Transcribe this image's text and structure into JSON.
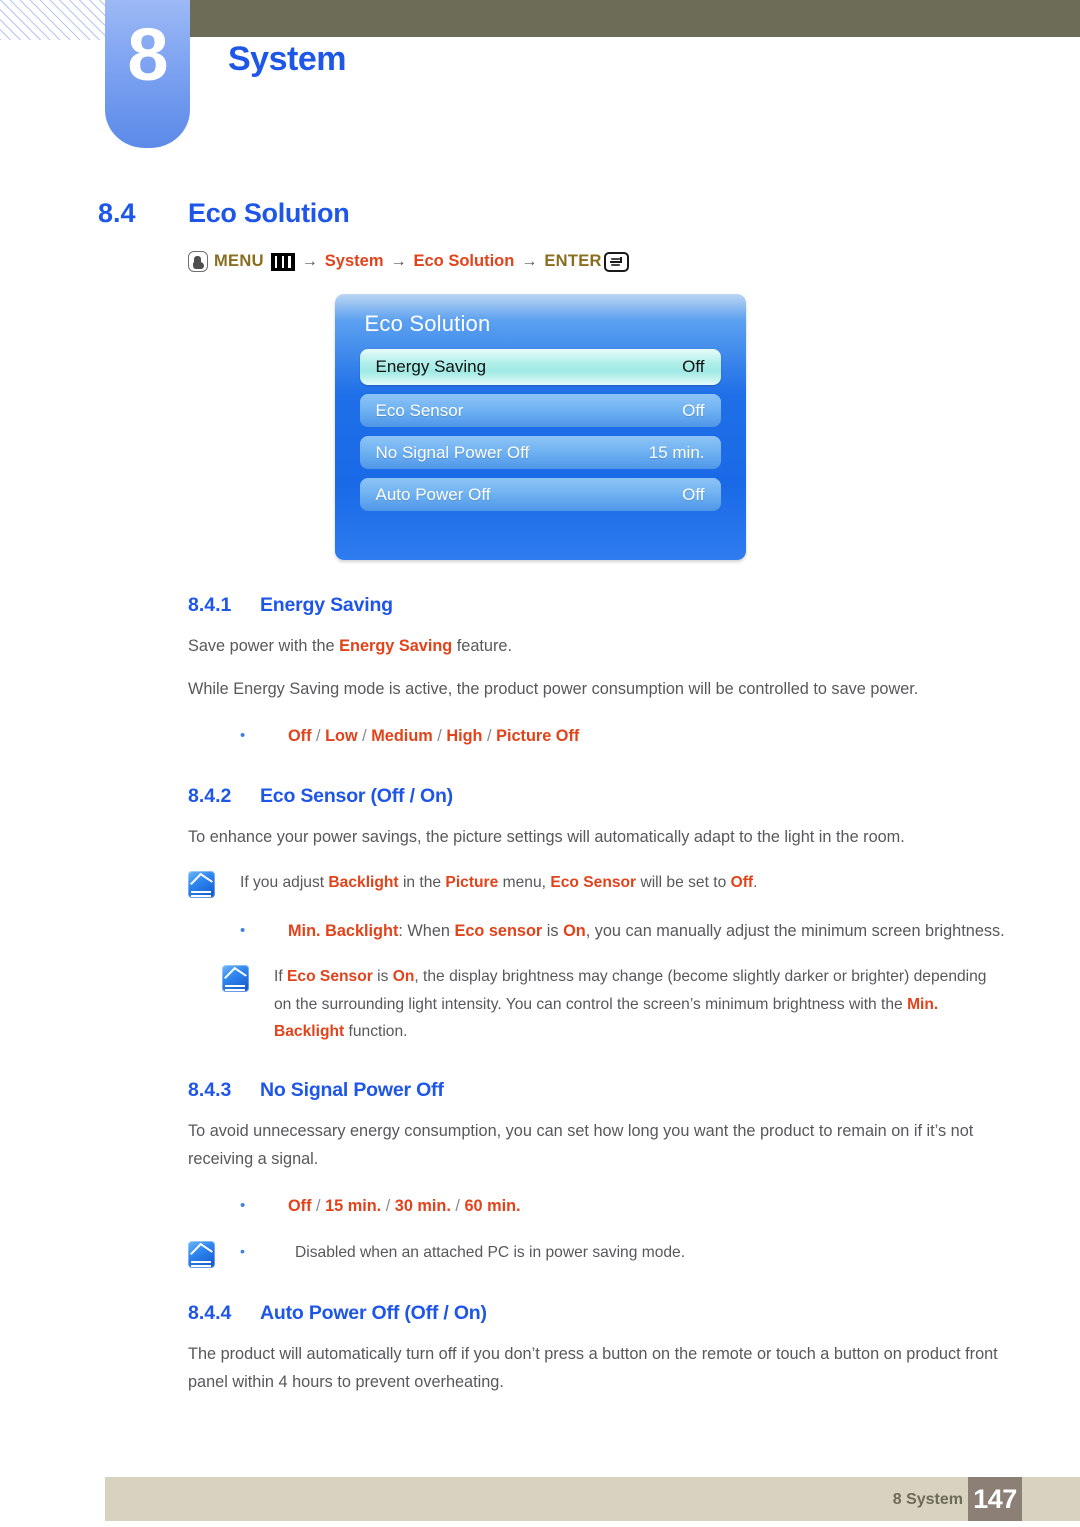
{
  "header": {
    "chapter_number": "8",
    "chapter_title": "System"
  },
  "section": {
    "number": "8.4",
    "title": "Eco Solution"
  },
  "menu_path": {
    "menu_label": "MENU",
    "arrow": "→",
    "system_label": "System",
    "eco_solution_label": "Eco Solution",
    "enter_label": "ENTER",
    "hand_icon": "hand-pointer-icon",
    "menu_bars_icon": "menu-bars-icon",
    "enter_key_icon": "enter-key-icon"
  },
  "osd": {
    "title": "Eco Solution",
    "rows": [
      {
        "label": "Energy Saving",
        "value": "Off",
        "selected": true
      },
      {
        "label": "Eco Sensor",
        "value": "Off",
        "selected": false
      },
      {
        "label": "No Signal Power Off",
        "value": "15 min.",
        "selected": false
      },
      {
        "label": "Auto Power Off",
        "value": "Off",
        "selected": false
      }
    ]
  },
  "subsections": {
    "s1": {
      "number": "8.4.1",
      "title": "Energy Saving",
      "p1_a": "Save power with the ",
      "p1_b": "Energy Saving",
      "p1_c": " feature.",
      "p2": "While Energy Saving mode is active, the product power consumption will be controlled to save power.",
      "options": {
        "o1": "Off",
        "o2": "Low",
        "o3": "Medium",
        "o4": "High",
        "o5": "Picture Off",
        "sep": " / "
      }
    },
    "s2": {
      "number": "8.4.2",
      "title": "Eco Sensor (Off / On)",
      "p1": "To enhance your power savings, the picture settings will automatically adapt to the light in the room.",
      "note1": {
        "a": "If you adjust ",
        "b": "Backlight",
        "c": " in the ",
        "d": "Picture",
        "e": " menu, ",
        "f": "Eco Sensor",
        "g": " will be set to ",
        "h": "Off",
        "i": "."
      },
      "bullet1": {
        "a": "Min. Backlight",
        "b": ": When ",
        "c": "Eco sensor",
        "d": " is ",
        "e": "On",
        "f": ", you can manually adjust the minimum screen brightness."
      },
      "note2": {
        "a": "If ",
        "b": "Eco Sensor",
        "c": " is ",
        "d": "On",
        "e": ", the display brightness may change (become slightly darker or brighter) depending on the surrounding light intensity. You can control the screen’s minimum brightness with the ",
        "f": "Min. Backlight",
        "g": " function."
      }
    },
    "s3": {
      "number": "8.4.3",
      "title": "No Signal Power Off",
      "p1": "To avoid unnecessary energy consumption, you can set how long you want the product to remain on if it’s not receiving a signal.",
      "options": {
        "o1": "Off",
        "o2": "15 min.",
        "o3": "30 min.",
        "o4": "60 min.",
        "sep": " / "
      },
      "note1": "Disabled when an attached PC is in power saving mode."
    },
    "s4": {
      "number": "8.4.4",
      "title": "Auto Power Off (Off / On)",
      "p1": "The product will automatically turn off if you don’t press a button on the remote or touch a button on product front panel within 4 hours to prevent overheating."
    }
  },
  "footer": {
    "label": "8 System",
    "page": "147"
  },
  "colors": {
    "heading_blue": "#1e56e8",
    "emphasis_red": "#e2431b",
    "menu_gold": "#8a6d1f",
    "olive": "#6d6c57",
    "footer_beige": "#d8d2c0",
    "page_box": "#8c7f75",
    "body_gray": "#58585a"
  }
}
